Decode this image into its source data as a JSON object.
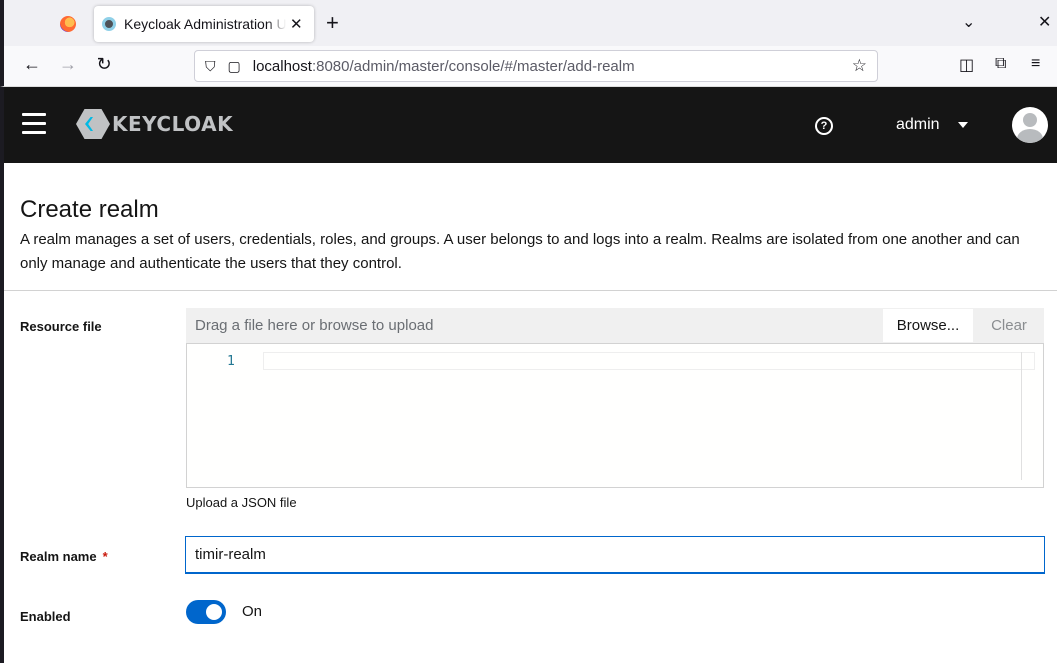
{
  "browser": {
    "tab_title": "Keycloak Administration UI",
    "url_host": "localhost",
    "url_rest": ":8080/admin/master/console/#/master/add-realm",
    "tab_close": "✕",
    "new_tab": "+"
  },
  "header": {
    "brand": "KEYCLOAK",
    "user": "admin"
  },
  "page": {
    "title": "Create realm",
    "description": "A realm manages a set of users, credentials, roles, and groups. A user belongs to and logs into a realm. Realms are isolated from one another and can only manage and authenticate the users that they control."
  },
  "form": {
    "resource_file_label": "Resource file",
    "file_placeholder": "Drag a file here or browse to upload",
    "browse_label": "Browse...",
    "clear_label": "Clear",
    "editor_line_number": "1",
    "helper_text": "Upload a JSON file",
    "realm_name_label": "Realm name",
    "required_mark": "*",
    "realm_name_value": "timir-realm",
    "enabled_label": "Enabled",
    "enabled_state": "On"
  },
  "colors": {
    "accent": "#0066cc",
    "header_bg": "#151515",
    "required": "#c9190b"
  }
}
